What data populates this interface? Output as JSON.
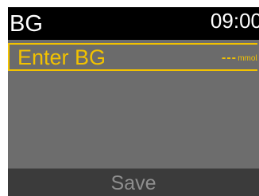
{
  "header": {
    "title": "BG",
    "time": "09:00"
  },
  "bg_entry": {
    "label": "Enter BG",
    "value": "---",
    "unit": "mmol/L"
  },
  "footer": {
    "save_label": "Save"
  },
  "colors": {
    "accent": "#f2c200",
    "title_bar": "#000000",
    "content_bg": "#6d6d6d",
    "footer_bg": "#3b3b3b",
    "disabled_text": "#8e8e8e"
  }
}
